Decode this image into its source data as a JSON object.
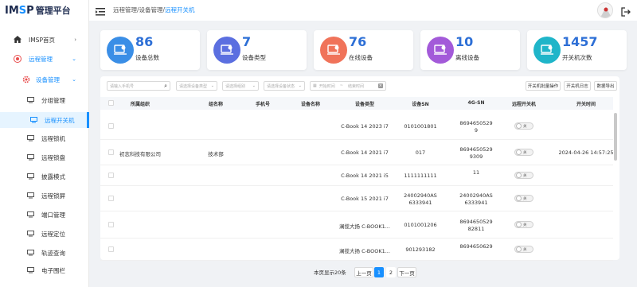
{
  "app": {
    "brand_a": "IM",
    "brand_sp": "S",
    "brand_b": "P",
    "subtitle": "管理平台"
  },
  "breadcrumb": {
    "path": "远程管理/设备管理/",
    "current": "远程开关机"
  },
  "sidebar": {
    "items": [
      {
        "label": "IMSP首页",
        "icon": "home-icon"
      },
      {
        "label": "远程管理",
        "icon": "remote-icon"
      },
      {
        "label": "设备管理",
        "icon": "gear-icon"
      },
      {
        "label": "分组管理",
        "icon": "group-icon"
      },
      {
        "label": "远程开关机",
        "icon": "power-icon"
      },
      {
        "label": "远程锁机",
        "icon": "lock-icon"
      },
      {
        "label": "远程锁盘",
        "icon": "disk-icon"
      },
      {
        "label": "披露模式",
        "icon": "mode-icon"
      },
      {
        "label": "远程锁屏",
        "icon": "screen-icon"
      },
      {
        "label": "端口管理",
        "icon": "port-icon"
      },
      {
        "label": "远程定位",
        "icon": "locate-icon"
      },
      {
        "label": "轨迹查询",
        "icon": "track-icon"
      },
      {
        "label": "电子围栏",
        "icon": "fence-icon"
      }
    ]
  },
  "cards": [
    {
      "value": "86",
      "label": "设备总数",
      "color": "#3a8ee6"
    },
    {
      "value": "7",
      "label": "设备类型",
      "color": "#5b6fe0"
    },
    {
      "value": "76",
      "label": "在线设备",
      "color": "#f0735a"
    },
    {
      "value": "10",
      "label": "离线设备",
      "color": "#a35ad9"
    },
    {
      "value": "1457",
      "label": "开关机次数",
      "color": "#1fb5c9"
    }
  ],
  "filters": {
    "search_placeholder": "请输入手机号",
    "type": "请选择设备类型",
    "group": "请选择组别",
    "status": "请选择设备状态",
    "start": "开始时间",
    "sep": "~",
    "end": "结束时间"
  },
  "actions": {
    "batch": "开关机批量操作",
    "log": "开关机日志",
    "export": "数据导出"
  },
  "table": {
    "headers": [
      "所属组织",
      "组名称",
      "手机号",
      "设备名称",
      "设备类型",
      "设备SN",
      "4G-SN",
      "远程开关机",
      "开关时间"
    ],
    "rows": [
      {
        "org": "",
        "group": "",
        "phone": "",
        "name": "",
        "type": "C-Book 14 2023 i7",
        "sn": "0101001801",
        "sn4g": [
          "8694650529",
          "9"
        ],
        "toggle": "关",
        "time": ""
      },
      {
        "org": "初志科技有限公司",
        "group": "技术部",
        "phone": "",
        "name": "",
        "type": "C-Book 14 2021 i7",
        "sn": "017",
        "sn4g": [
          "8694650529",
          "9309"
        ],
        "toggle": "关",
        "time": "2024-04-26 14:57:25"
      },
      {
        "org": "",
        "group": "",
        "phone": "",
        "name": "",
        "type": "C-Book 14 2021 i5",
        "sn": "1111111111",
        "sn4g": [
          "11"
        ],
        "toggle": "关",
        "time": ""
      },
      {
        "org": "",
        "group": "",
        "phone": "",
        "name": "",
        "type": "C-Book 15 2021 i7",
        "sn": [
          "24002940AS",
          "6333941"
        ],
        "sn4g": [
          "24002940AS",
          "6333941"
        ],
        "toggle": "关",
        "time": ""
      },
      {
        "org": "",
        "group": "",
        "phone": "",
        "name": "",
        "type": "澜揽大扬 C-BOOK1...",
        "sn": "0101001206",
        "sn4g": [
          "8694650529",
          "82811"
        ],
        "toggle": "关",
        "time": ""
      },
      {
        "org": "",
        "group": "",
        "phone": "",
        "name": "",
        "type": "澜揽大扬 C-BOOK1...",
        "sn": "901293182",
        "sn4g": [
          "8694650629",
          ""
        ],
        "toggle": "关",
        "time": ""
      }
    ]
  },
  "pagination": {
    "info": "本页显示20条",
    "prev": "上一页",
    "pages": [
      "1",
      "2"
    ],
    "next": "下一页",
    "current": "1"
  }
}
